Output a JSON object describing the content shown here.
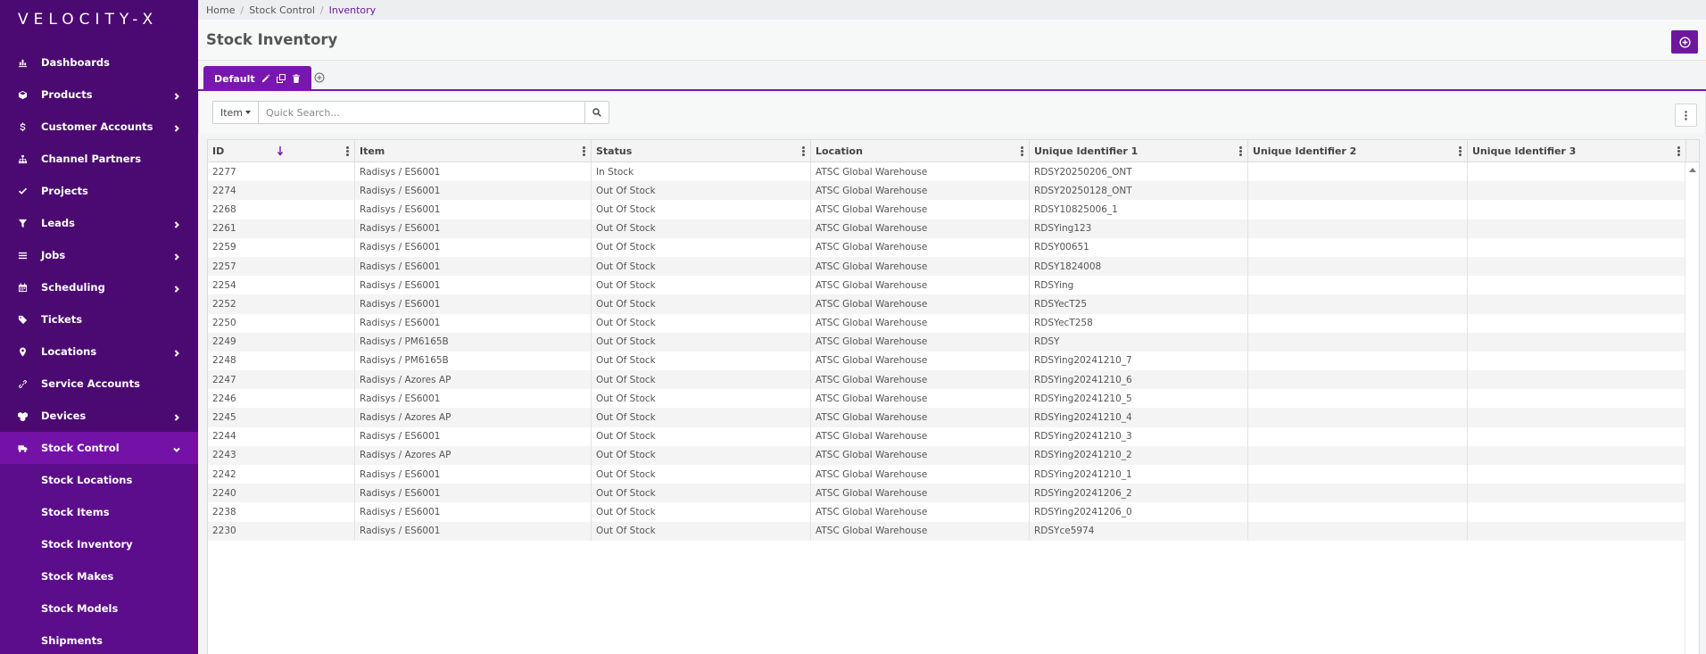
{
  "app": {
    "logo": "VELOCITY-X"
  },
  "sidebar": {
    "items": [
      {
        "label": "Dashboards",
        "icon": "bar-chart-icon",
        "chevron": false
      },
      {
        "label": "Products",
        "icon": "cube-icon",
        "chevron": true
      },
      {
        "label": "Customer Accounts",
        "icon": "dollar-icon",
        "chevron": true
      },
      {
        "label": "Channel Partners",
        "icon": "sitemap-icon",
        "chevron": false
      },
      {
        "label": "Projects",
        "icon": "check-icon",
        "chevron": false
      },
      {
        "label": "Leads",
        "icon": "filter-icon",
        "chevron": true
      },
      {
        "label": "Jobs",
        "icon": "list-icon",
        "chevron": true
      },
      {
        "label": "Scheduling",
        "icon": "calendar-icon",
        "chevron": true
      },
      {
        "label": "Tickets",
        "icon": "tag-icon",
        "chevron": false
      },
      {
        "label": "Locations",
        "icon": "map-pin-icon",
        "chevron": true
      },
      {
        "label": "Service Accounts",
        "icon": "link-icon",
        "chevron": false
      },
      {
        "label": "Devices",
        "icon": "devices-icon",
        "chevron": true
      },
      {
        "label": "Stock Control",
        "icon": "truck-icon",
        "chevron": true
      }
    ],
    "stock_sub": [
      "Stock Locations",
      "Stock Items",
      "Stock Inventory",
      "Stock Makes",
      "Stock Models",
      "Shipments"
    ]
  },
  "breadcrumb": {
    "home": "Home",
    "section": "Stock Control",
    "current": "Inventory"
  },
  "page": {
    "title": "Stock Inventory"
  },
  "tabs": {
    "default_label": "Default"
  },
  "search": {
    "filter_value": "Item",
    "placeholder": "Quick Search..."
  },
  "grid": {
    "columns": [
      "ID",
      "Item",
      "Status",
      "Location",
      "Unique Identifier 1",
      "Unique Identifier 2",
      "Unique Identifier 3"
    ],
    "rows": [
      [
        "2277",
        "Radisys / ES6001",
        "In Stock",
        "ATSC Global Warehouse",
        "RDSY20250206_ONT",
        "",
        ""
      ],
      [
        "2274",
        "Radisys / ES6001",
        "Out Of Stock",
        "ATSC Global Warehouse",
        "RDSY20250128_ONT",
        "",
        ""
      ],
      [
        "2268",
        "Radisys / ES6001",
        "Out Of Stock",
        "ATSC Global Warehouse",
        "RDSY10825006_1",
        "",
        ""
      ],
      [
        "2261",
        "Radisys / ES6001",
        "Out Of Stock",
        "ATSC Global Warehouse",
        "RDSYing123",
        "",
        ""
      ],
      [
        "2259",
        "Radisys / ES6001",
        "Out Of Stock",
        "ATSC Global Warehouse",
        "RDSY00651",
        "",
        ""
      ],
      [
        "2257",
        "Radisys / ES6001",
        "Out Of Stock",
        "ATSC Global Warehouse",
        "RDSY1824008",
        "",
        ""
      ],
      [
        "2254",
        "Radisys / ES6001",
        "Out Of Stock",
        "ATSC Global Warehouse",
        "RDSYing",
        "",
        ""
      ],
      [
        "2252",
        "Radisys / ES6001",
        "Out Of Stock",
        "ATSC Global Warehouse",
        "RDSYecT25",
        "",
        ""
      ],
      [
        "2250",
        "Radisys / ES6001",
        "Out Of Stock",
        "ATSC Global Warehouse",
        "RDSYecT258",
        "",
        ""
      ],
      [
        "2249",
        "Radisys / PM6165B",
        "Out Of Stock",
        "ATSC Global Warehouse",
        "RDSY",
        "",
        ""
      ],
      [
        "2248",
        "Radisys / PM6165B",
        "Out Of Stock",
        "ATSC Global Warehouse",
        "RDSYing20241210_7",
        "",
        ""
      ],
      [
        "2247",
        "Radisys / Azores AP",
        "Out Of Stock",
        "ATSC Global Warehouse",
        "RDSYing20241210_6",
        "",
        ""
      ],
      [
        "2246",
        "Radisys / ES6001",
        "Out Of Stock",
        "ATSC Global Warehouse",
        "RDSYing20241210_5",
        "",
        ""
      ],
      [
        "2245",
        "Radisys / Azores AP",
        "Out Of Stock",
        "ATSC Global Warehouse",
        "RDSYing20241210_4",
        "",
        ""
      ],
      [
        "2244",
        "Radisys / ES6001",
        "Out Of Stock",
        "ATSC Global Warehouse",
        "RDSYing20241210_3",
        "",
        ""
      ],
      [
        "2243",
        "Radisys / Azores AP",
        "Out Of Stock",
        "ATSC Global Warehouse",
        "RDSYing20241210_2",
        "",
        ""
      ],
      [
        "2242",
        "Radisys / ES6001",
        "Out Of Stock",
        "ATSC Global Warehouse",
        "RDSYing20241210_1",
        "",
        ""
      ],
      [
        "2240",
        "Radisys / ES6001",
        "Out Of Stock",
        "ATSC Global Warehouse",
        "RDSYing20241206_2",
        "",
        ""
      ],
      [
        "2238",
        "Radisys / ES6001",
        "Out Of Stock",
        "ATSC Global Warehouse",
        "RDSYing20241206_0",
        "",
        ""
      ],
      [
        "2230",
        "Radisys / ES6001",
        "Out Of Stock",
        "ATSC Global Warehouse",
        "RDSYce5974",
        "",
        ""
      ]
    ]
  },
  "colors": {
    "sidebar": "#4b0a72",
    "accent": "#7a16b0",
    "active": "#7412a8"
  }
}
